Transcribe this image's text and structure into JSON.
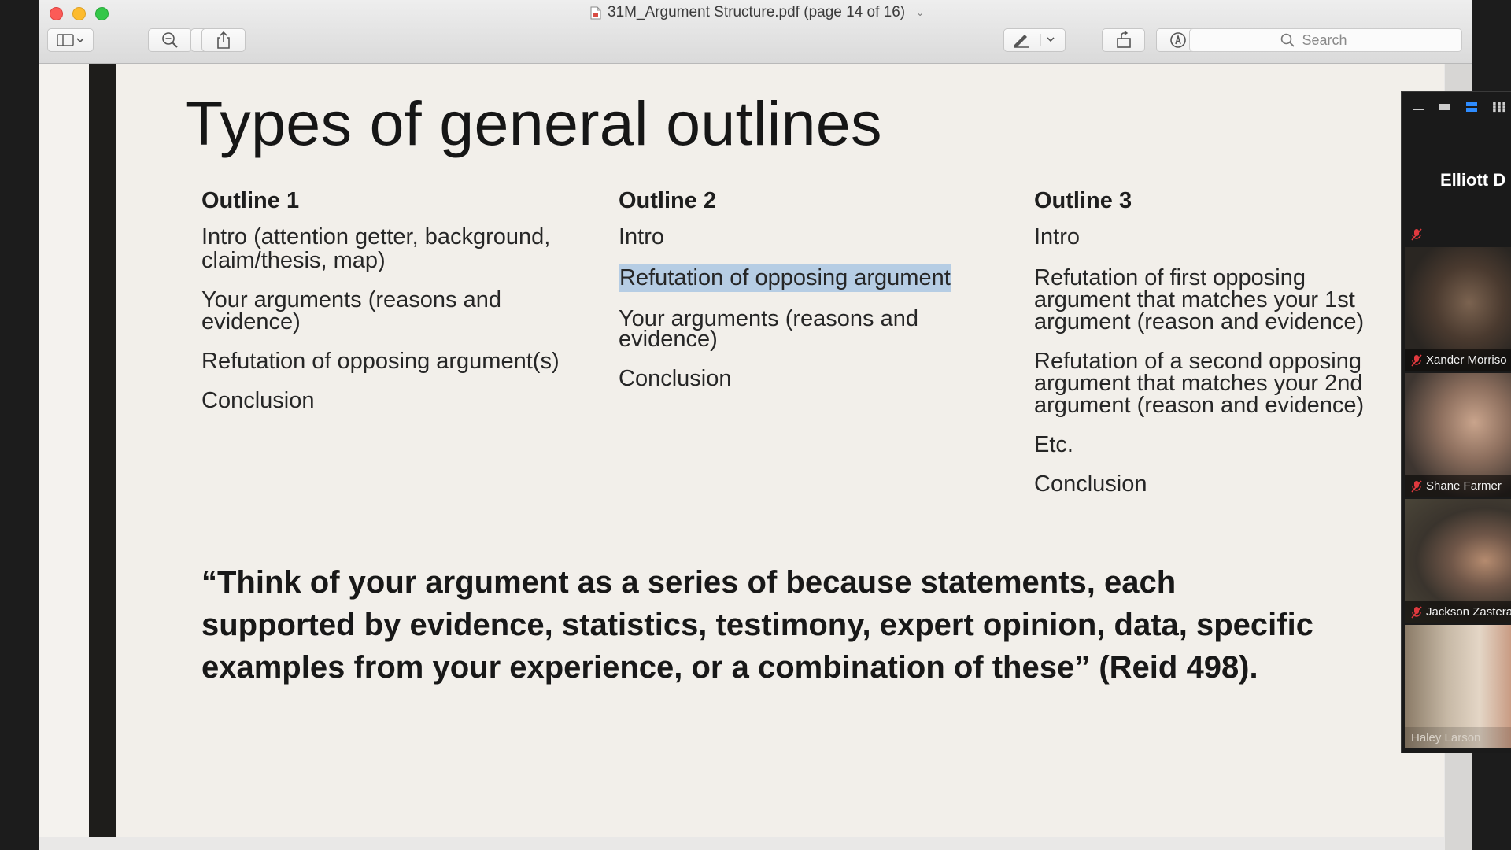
{
  "window": {
    "title": "31M_Argument Structure.pdf (page 14 of 16)"
  },
  "toolbar": {
    "sidebar_toggle": "sidebar-toggle",
    "zoom_out": "zoom-out",
    "zoom_in": "zoom-in",
    "share": "share",
    "markup_pen": "pen",
    "rotate": "rotate",
    "markup_toolbar": "markup",
    "search_placeholder": "Search"
  },
  "slide": {
    "title": "Types of general outlines",
    "columns": [
      {
        "heading": "Outline 1",
        "items": [
          "Intro (attention getter, background,",
          "claim/thesis, map)",
          "Your arguments (reasons and",
          "evidence)",
          "Refutation of opposing argument(s)",
          "Conclusion"
        ]
      },
      {
        "heading": "Outline 2",
        "items": [
          "Intro",
          "Refutation of opposing argument",
          "Your arguments (reasons and",
          "evidence)",
          "Conclusion"
        ]
      },
      {
        "heading": "Outline 3",
        "items": [
          "Intro",
          "Refutation of first opposing",
          "argument that matches your 1st",
          "argument (reason and evidence)",
          "Refutation of a second opposing",
          "argument that matches your 2nd",
          "argument (reason and evidence)",
          "Etc.",
          "Conclusion"
        ]
      }
    ],
    "quote": "“Think of your argument as a series of because statements, each supported by evidence, statistics, testimony, expert opinion, data, specific examples from your experience, or a combination of these” (Reid 498)."
  },
  "zoom": {
    "speaker": "Elliott D",
    "participants": [
      {
        "name": "Xander Morriso",
        "muted": true
      },
      {
        "name": "Shane Farmer",
        "muted": true
      },
      {
        "name": "Jackson Zastera",
        "muted": true
      },
      {
        "name": "Haley Larson",
        "muted": false
      }
    ]
  },
  "colors": {
    "highlight": "#b6cde4",
    "mic_muted": "#e0393e"
  }
}
